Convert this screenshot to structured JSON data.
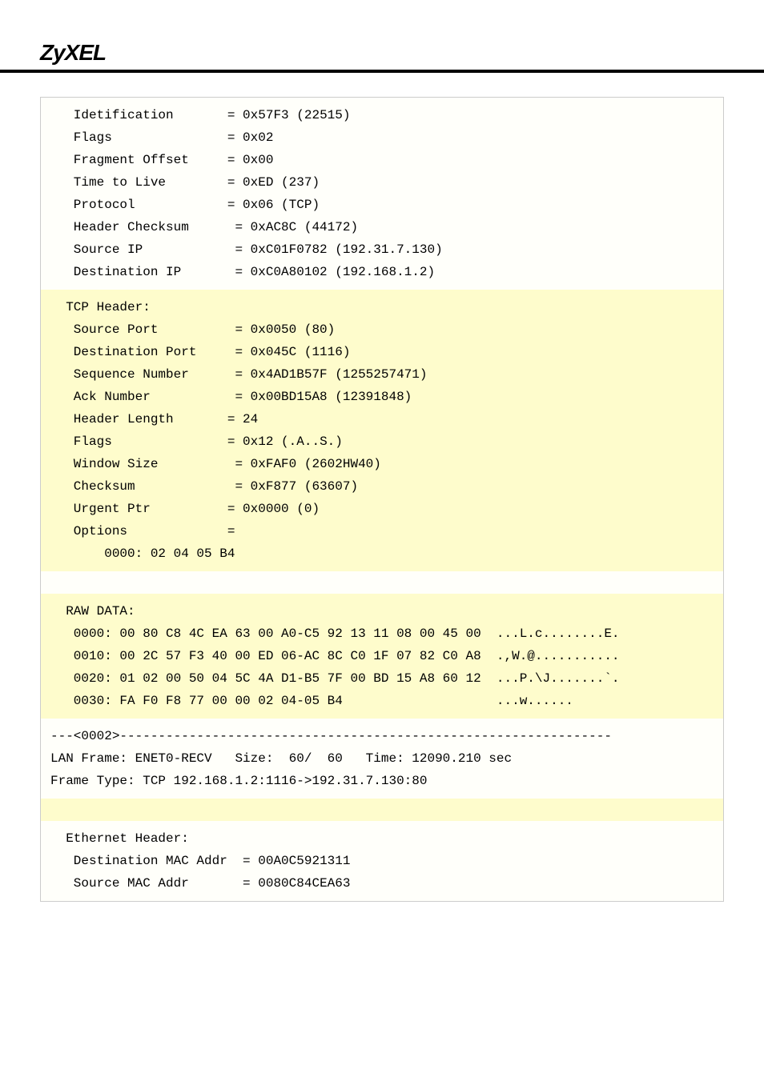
{
  "logo": "ZyXEL",
  "ipheader": {
    "identification_label": "   Idetification       ",
    "identification_value": "= 0x57F3 (22515)",
    "flags_label": "   Flags               ",
    "flags_value": "= 0x02",
    "fragment_offset_label": "   Fragment Offset     ",
    "fragment_offset_value": "= 0x00",
    "ttl_label": "   Time to Live        ",
    "ttl_value": "= 0xED (237)",
    "protocol_label": "   Protocol            ",
    "protocol_value": "= 0x06 (TCP)",
    "checksum_label": "   Header Checksum      ",
    "checksum_value": "= 0xAC8C (44172)",
    "source_ip_label": "   Source IP            ",
    "source_ip_value": "= 0xC01F0782 (192.31.7.130)",
    "dest_ip_label": "   Destination IP       ",
    "dest_ip_value": "= 0xC0A80102 (192.168.1.2)"
  },
  "tcpheader": {
    "title": "  TCP Header:",
    "src_port_label": "   Source Port          ",
    "src_port_value": "= 0x0050 (80)",
    "dst_port_label": "   Destination Port     ",
    "dst_port_value": "= 0x045C (1116)",
    "seq_label": "   Sequence Number      ",
    "seq_value": "= 0x4AD1B57F (1255257471)",
    "ack_label": "   Ack Number           ",
    "ack_value": "= 0x00BD15A8 (12391848)",
    "hlen_label": "   Header Length       ",
    "hlen_value": "= 24",
    "flags_label": "   Flags               ",
    "flags_value": "= 0x12 (.A..S.)",
    "win_label": "   Window Size          ",
    "win_value": "= 0xFAF0 (2602HW40)",
    "csum_label": "   Checksum             ",
    "csum_value": "= 0xF877 (63607)",
    "urg_label": "   Urgent Ptr          ",
    "urg_value": "= 0x0000 (0)",
    "opt_label": "   Options             ",
    "opt_value": "=",
    "opt_data": "       0000: 02 04 05 B4"
  },
  "rawdata": {
    "title": "  RAW DATA:",
    "line0": "   0000: 00 80 C8 4C EA 63 00 A0-C5 92 13 11 08 00 45 00  ...L.c........E.",
    "line1": "   0010: 00 2C 57 F3 40 00 ED 06-AC 8C C0 1F 07 82 C0 A8  .,W.@...........",
    "line2": "   0020: 01 02 00 50 04 5C 4A D1-B5 7F 00 BD 15 A8 60 12  ...P.\\J.......`.",
    "line3": "   0030: FA F0 F8 77 00 00 02 04-05 B4                    ...w......"
  },
  "frame": {
    "sep": "---<0002>----------------------------------------------------------------",
    "lan": "LAN Frame: ENET0-RECV   Size:  60/  60   Time: 12090.210 sec",
    "type": "Frame Type: TCP 192.168.1.2:1116->192.31.7.130:80"
  },
  "eth": {
    "title": "  Ethernet Header:",
    "dst_label": "   Destination MAC Addr  ",
    "dst_value": "= 00A0C5921311",
    "src_label": "   Source MAC Addr       ",
    "src_value": "= 0080C84CEA63"
  }
}
